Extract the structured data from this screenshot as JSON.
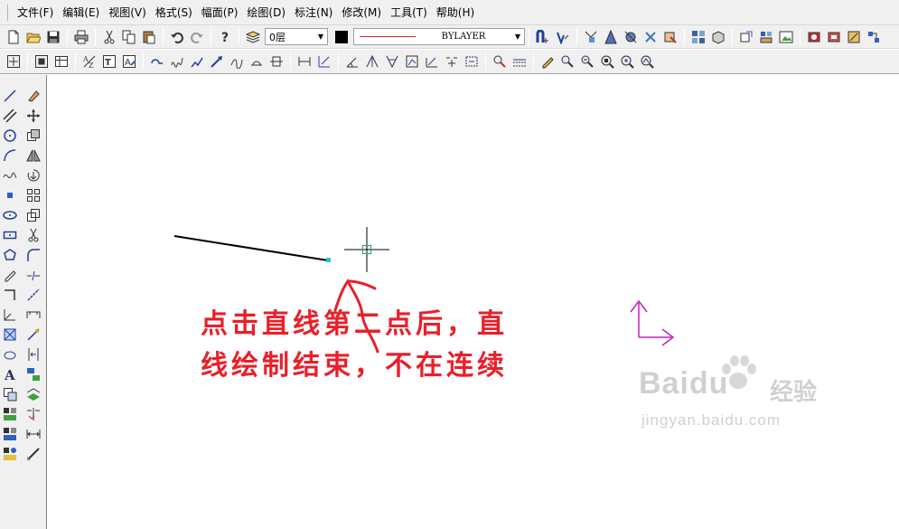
{
  "menubar": {
    "items": [
      "文件(F)",
      "编辑(E)",
      "视图(V)",
      "格式(S)",
      "幅面(P)",
      "绘图(D)",
      "标注(N)",
      "修改(M)",
      "工具(T)",
      "帮助(H)"
    ]
  },
  "toolbar": {
    "layer_value": "0层",
    "linetype_value": "BYLAYER",
    "current_color": "#000000",
    "linetype_color": "#d8262b"
  },
  "annotation": {
    "line1": "点击直线第二点后，直",
    "line2": "线绘制结束，不在连续",
    "color": "#e8202a"
  },
  "watermark": {
    "logo": "Baidu",
    "brand": "经验",
    "url": "jingyan.baidu.com"
  },
  "icons": {
    "row1": [
      "new-file-icon",
      "open-folder-icon",
      "save-icon",
      "print-icon",
      "cut-icon",
      "copy-icon",
      "paste-icon",
      "undo-icon",
      "redo-icon",
      "help-icon",
      "layer-manager-icon",
      "snap-icon",
      "osnap-icon",
      "measure-icon",
      "point-filter-icon",
      "properties-icon",
      "clear-icon",
      "block-icon",
      "insert-block-icon",
      "attribute-icon",
      "group-icon",
      "explode-icon",
      "image-icon",
      "tool-a-icon",
      "tool-b-icon",
      "tool-c-icon",
      "tool-d-icon"
    ],
    "row2": [
      "zoom-window-icon",
      "zoom-extents-icon",
      "table-icon",
      "text-style-icon",
      "text-icon",
      "edit-text-icon",
      "line-arc-icon",
      "curve-icon",
      "polyline-icon",
      "arrow-icon",
      "spline-icon",
      "hatch-icon",
      "pan-icon",
      "dimension-linear-icon",
      "dimension-aligned-icon",
      "dimension-angle-icon",
      "dimension-radius-icon",
      "dimension-diameter-icon",
      "leader-icon",
      "tolerance-icon",
      "ordinate-icon",
      "dim-edit-icon",
      "dim-style-icon",
      "pencil-icon",
      "magnify-icon",
      "zoom-in-icon",
      "zoom-out-icon",
      "zoom-prev-icon",
      "zoom-realtime-icon"
    ],
    "draw_col": [
      "line-icon",
      "double-line-icon",
      "circle-icon",
      "arc-icon",
      "spline-curve-icon",
      "point-icon",
      "ellipse-icon",
      "rectangle-icon",
      "polygon-icon",
      "pen-icon",
      "corner-icon",
      "angle-icon",
      "hatch-area-icon",
      "cloud-icon",
      "text-tool-icon",
      "layer-tool-icon",
      "block-tool-icon",
      "insert-tool-icon",
      "attribute-tool-icon"
    ],
    "modify_col": [
      "erase-icon",
      "move-icon",
      "copy-object-icon",
      "mirror-icon",
      "rotate-icon",
      "array-icon",
      "scale-icon",
      "trim-icon",
      "fillet-icon",
      "break-icon",
      "extend-icon",
      "chamfer-icon",
      "explode-object-icon",
      "stretch-icon",
      "match-icon",
      "offset-icon",
      "align-icon",
      "lengthen-icon",
      "brush-icon"
    ]
  }
}
